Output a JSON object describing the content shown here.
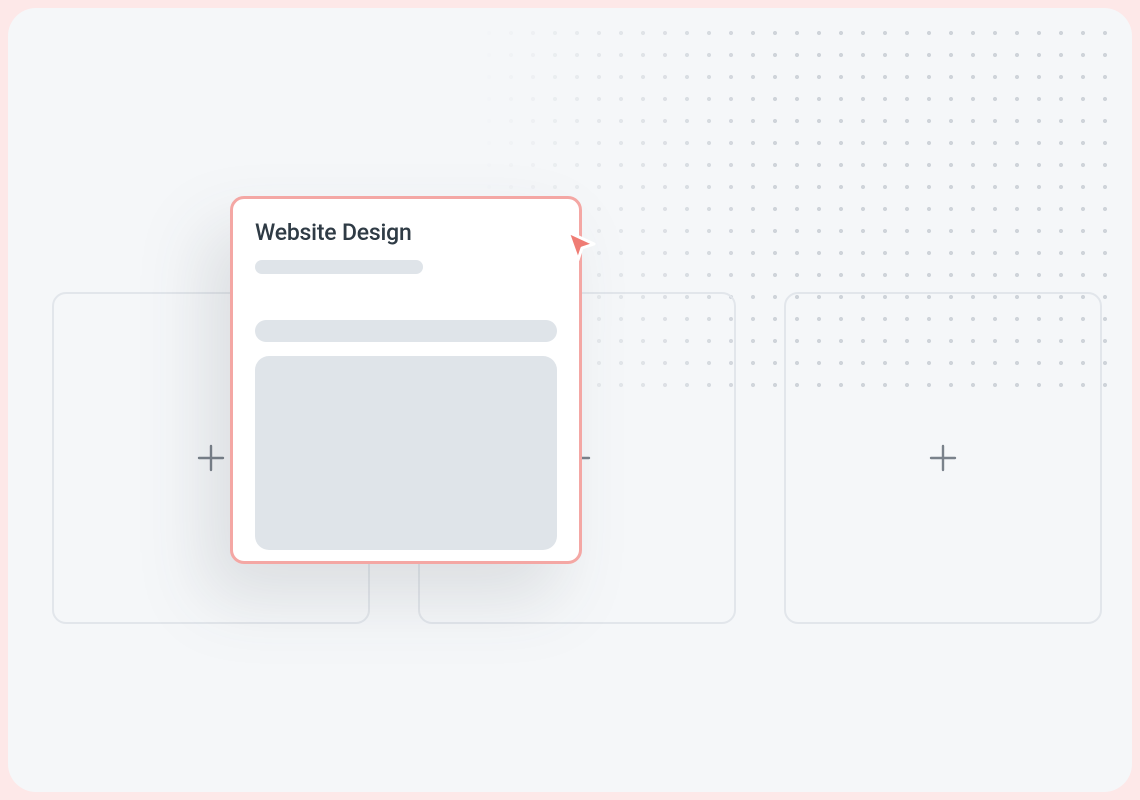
{
  "colors": {
    "page_bg": "#fde8e8",
    "stage_bg": "#f5f7f9",
    "slot_border": "#e2e6eb",
    "plus": "#7a828b",
    "card_border": "#f4a7a4",
    "card_title": "#2f3b45",
    "skeleton": "#dfe4e9",
    "cursor_fill": "#ef7c74",
    "cursor_stroke": "#ffffff"
  },
  "slots": [
    {
      "id": "slot-1",
      "icon": "plus-icon"
    },
    {
      "id": "slot-2",
      "icon": "plus-icon"
    },
    {
      "id": "slot-3",
      "icon": "plus-icon"
    }
  ],
  "card": {
    "title": "Website Design"
  },
  "cursor": {
    "icon": "drag-cursor-icon"
  }
}
